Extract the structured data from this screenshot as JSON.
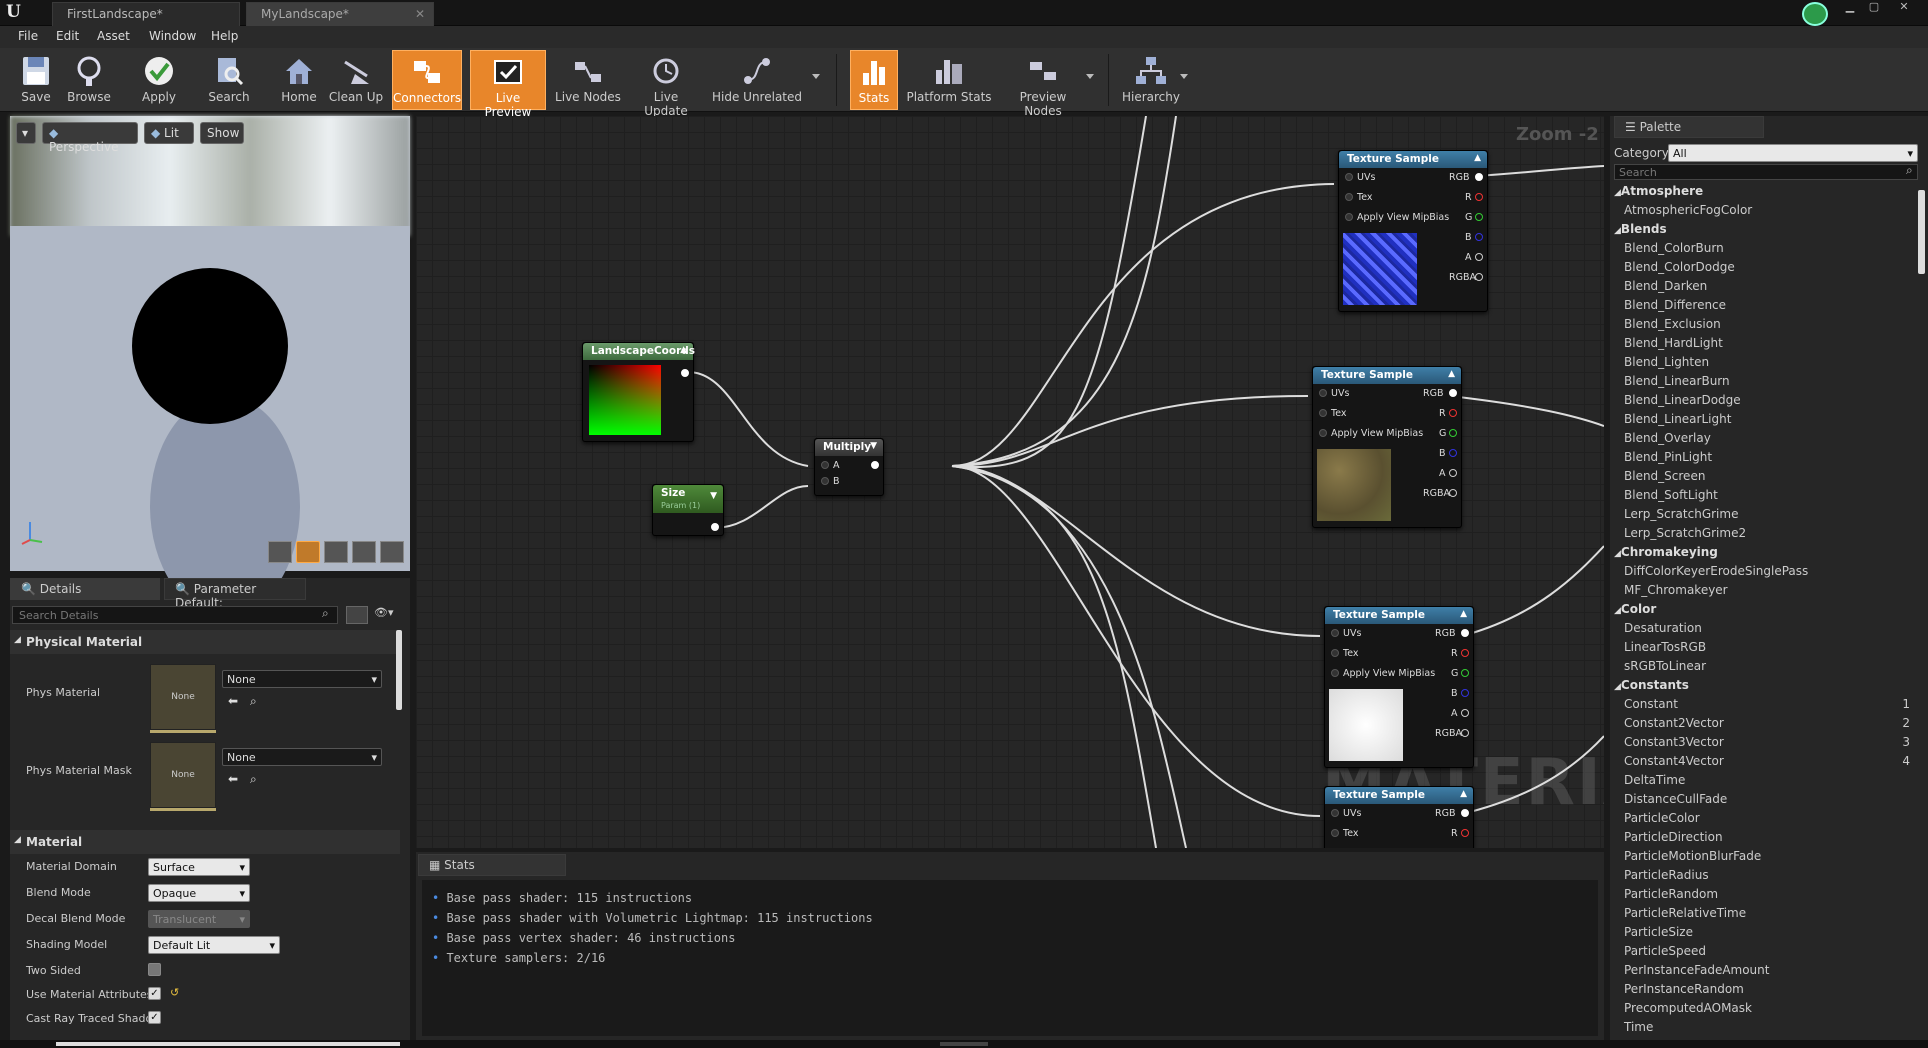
{
  "titlebar": {
    "tabs": [
      {
        "label": "FirstLandscape*"
      },
      {
        "label": "MyLandscape*"
      }
    ]
  },
  "menu": {
    "items": [
      "File",
      "Edit",
      "Asset",
      "Window",
      "Help"
    ]
  },
  "toolbar": {
    "buttons": [
      {
        "label": "Save",
        "icon": "save-icon"
      },
      {
        "label": "Browse",
        "icon": "browse-icon"
      },
      {
        "label": "Apply",
        "icon": "apply-icon"
      },
      {
        "label": "Search",
        "icon": "search-icon"
      },
      {
        "label": "Home",
        "icon": "home-icon"
      },
      {
        "label": "Clean Up",
        "icon": "cleanup-icon"
      },
      {
        "label": "Connectors",
        "icon": "connectors-icon",
        "active": true
      },
      {
        "label": "Live Preview",
        "icon": "live-preview-icon",
        "active": true
      },
      {
        "label": "Live Nodes",
        "icon": "live-nodes-icon"
      },
      {
        "label": "Live Update",
        "icon": "live-update-icon"
      },
      {
        "label": "Hide Unrelated",
        "icon": "hide-unrelated-icon"
      },
      {
        "label": "Stats",
        "icon": "stats-icon",
        "active": true
      },
      {
        "label": "Platform Stats",
        "icon": "platform-stats-icon"
      },
      {
        "label": "Preview Nodes",
        "icon": "preview-nodes-icon"
      },
      {
        "label": "Hierarchy",
        "icon": "hierarchy-icon"
      }
    ]
  },
  "viewport": {
    "perspective": "Perspective",
    "lit": "Lit",
    "show": "Show"
  },
  "details": {
    "tab1": "Details",
    "tab2": "Parameter Default:",
    "search_placeholder": "Search Details",
    "section_physical": "Physical Material",
    "phys_material": "Phys Material",
    "phys_material_mask": "Phys Material Mask",
    "none": "None",
    "thumb_none": "None",
    "section_material": "Material",
    "props": [
      {
        "label": "Material Domain",
        "value": "Surface"
      },
      {
        "label": "Blend Mode",
        "value": "Opaque"
      },
      {
        "label": "Decal Blend Mode",
        "value": "Translucent"
      },
      {
        "label": "Shading Model",
        "value": "Default Lit"
      },
      {
        "label": "Two Sided",
        "value": ""
      },
      {
        "label": "Use Material Attributes",
        "value": ""
      },
      {
        "label": "Cast Ray Traced Shado",
        "value": ""
      }
    ]
  },
  "graph": {
    "zoom": "Zoom -2",
    "watermark": "MATERIAL",
    "landscape_coords": "LandscapeCoords",
    "size_title": "Size",
    "size_sub": "Param (1)",
    "multiply": "Multiply",
    "pin_a": "A",
    "pin_b": "B",
    "texture_sample": "Texture Sample",
    "uvs": "UVs",
    "tex": "Tex",
    "mip": "Apply View MipBias",
    "rgb": "RGB",
    "r": "R",
    "g": "G",
    "b": "B",
    "a": "A",
    "rgba": "RGBA"
  },
  "stats": {
    "tab": "Stats",
    "lines": [
      "Base pass shader: 115 instructions",
      "Base pass shader with Volumetric Lightmap: 115 instructions",
      "Base pass vertex shader: 46 instructions",
      "Texture samplers: 2/16"
    ]
  },
  "palette": {
    "tab": "Palette",
    "category_label": "Category:",
    "category_value": "All",
    "search_placeholder": "Search",
    "entries": [
      {
        "t": "c",
        "label": "Atmosphere"
      },
      {
        "t": "i",
        "label": "AtmosphericFogColor"
      },
      {
        "t": "c",
        "label": "Blends"
      },
      {
        "t": "i",
        "label": "Blend_ColorBurn"
      },
      {
        "t": "i",
        "label": "Blend_ColorDodge"
      },
      {
        "t": "i",
        "label": "Blend_Darken"
      },
      {
        "t": "i",
        "label": "Blend_Difference"
      },
      {
        "t": "i",
        "label": "Blend_Exclusion"
      },
      {
        "t": "i",
        "label": "Blend_HardLight"
      },
      {
        "t": "i",
        "label": "Blend_Lighten"
      },
      {
        "t": "i",
        "label": "Blend_LinearBurn"
      },
      {
        "t": "i",
        "label": "Blend_LinearDodge"
      },
      {
        "t": "i",
        "label": "Blend_LinearLight"
      },
      {
        "t": "i",
        "label": "Blend_Overlay"
      },
      {
        "t": "i",
        "label": "Blend_PinLight"
      },
      {
        "t": "i",
        "label": "Blend_Screen"
      },
      {
        "t": "i",
        "label": "Blend_SoftLight"
      },
      {
        "t": "i",
        "label": "Lerp_ScratchGrime"
      },
      {
        "t": "i",
        "label": "Lerp_ScratchGrime2"
      },
      {
        "t": "c",
        "label": "Chromakeying"
      },
      {
        "t": "i",
        "label": "DiffColorKeyerErodeSinglePass"
      },
      {
        "t": "i",
        "label": "MF_Chromakeyer"
      },
      {
        "t": "c",
        "label": "Color"
      },
      {
        "t": "i",
        "label": "Desaturation"
      },
      {
        "t": "i",
        "label": "LinearTosRGB"
      },
      {
        "t": "i",
        "label": "sRGBToLinear"
      },
      {
        "t": "c",
        "label": "Constants"
      },
      {
        "t": "i",
        "label": "Constant",
        "key": "1"
      },
      {
        "t": "i",
        "label": "Constant2Vector",
        "key": "2"
      },
      {
        "t": "i",
        "label": "Constant3Vector",
        "key": "3"
      },
      {
        "t": "i",
        "label": "Constant4Vector",
        "key": "4"
      },
      {
        "t": "i",
        "label": "DeltaTime"
      },
      {
        "t": "i",
        "label": "DistanceCullFade"
      },
      {
        "t": "i",
        "label": "ParticleColor"
      },
      {
        "t": "i",
        "label": "ParticleDirection"
      },
      {
        "t": "i",
        "label": "ParticleMotionBlurFade"
      },
      {
        "t": "i",
        "label": "ParticleRadius"
      },
      {
        "t": "i",
        "label": "ParticleRandom"
      },
      {
        "t": "i",
        "label": "ParticleRelativeTime"
      },
      {
        "t": "i",
        "label": "ParticleSize"
      },
      {
        "t": "i",
        "label": "ParticleSpeed"
      },
      {
        "t": "i",
        "label": "PerInstanceFadeAmount"
      },
      {
        "t": "i",
        "label": "PerInstanceRandom"
      },
      {
        "t": "i",
        "label": "PrecomputedAOMask"
      },
      {
        "t": "i",
        "label": "Time"
      }
    ]
  }
}
